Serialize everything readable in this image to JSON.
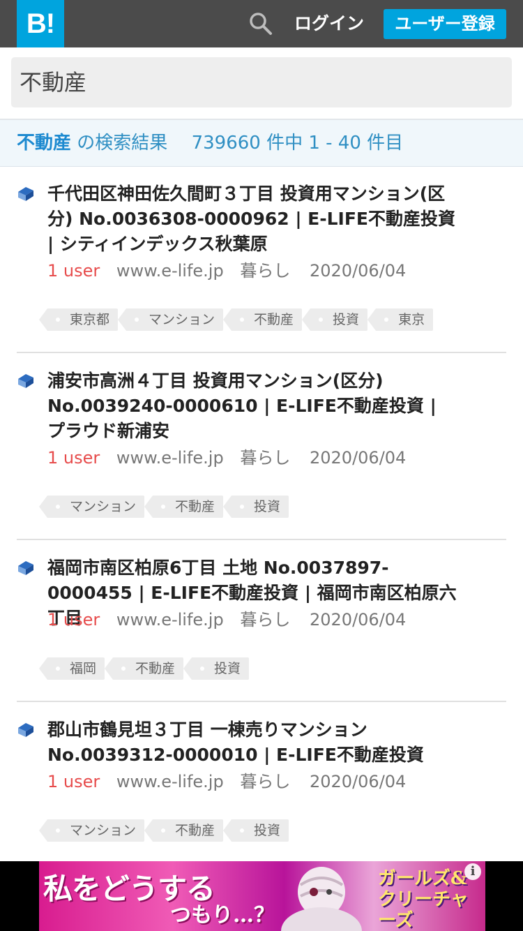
{
  "header": {
    "logo_text": "B!",
    "login_label": "ログイン",
    "register_label": "ユーザー登録"
  },
  "search": {
    "value": "不動産"
  },
  "results": {
    "keyword": "不動産",
    "suffix": "の検索結果",
    "count_text": "739660 件中 1 - 40 件目"
  },
  "entries": [
    {
      "title": "千代田区神田佐久間町３丁目 投資用マンション(区分) No.0036308-0000962 | E-LIFE不動産投資 | シティインデックス秋葉原",
      "users": "1 user",
      "domain": "www.e-life.jp",
      "category": "暮らし",
      "date": "2020/06/04",
      "tags": [
        "東京都",
        "マンション",
        "不動産",
        "投資",
        "東京"
      ]
    },
    {
      "title": "浦安市高洲４丁目 投資用マンション(区分) No.0039240-0000610 | E-LIFE不動産投資 | プラウド新浦安",
      "users": "1 user",
      "domain": "www.e-life.jp",
      "category": "暮らし",
      "date": "2020/06/04",
      "tags": [
        "マンション",
        "不動産",
        "投資"
      ]
    },
    {
      "title": "福岡市南区柏原6丁目 土地 No.0037897-0000455 | E-LIFE不動産投資 | 福岡市南区柏原六丁目",
      "users": "1 user",
      "domain": "www.e-life.jp",
      "category": "暮らし",
      "date": "2020/06/04",
      "tags": [
        "福岡",
        "不動産",
        "投資"
      ]
    },
    {
      "title": "郡山市鶴見坦３丁目 一棟売りマンション No.0039312-0000010 | E-LIFE不動産投資",
      "users": "1 user",
      "domain": "www.e-life.jp",
      "category": "暮らし",
      "date": "2020/06/04",
      "tags": [
        "マンション",
        "不動産",
        "投資"
      ]
    }
  ],
  "ad": {
    "text_main": "私をどうする",
    "text_sub": "つもり…？",
    "text_game": "ガールズ&クリーチャーズ",
    "info_glyph": "i"
  },
  "colors": {
    "header_bg": "#4b4b4b",
    "brand_blue": "#00a4de",
    "user_red": "#e74c4c"
  }
}
